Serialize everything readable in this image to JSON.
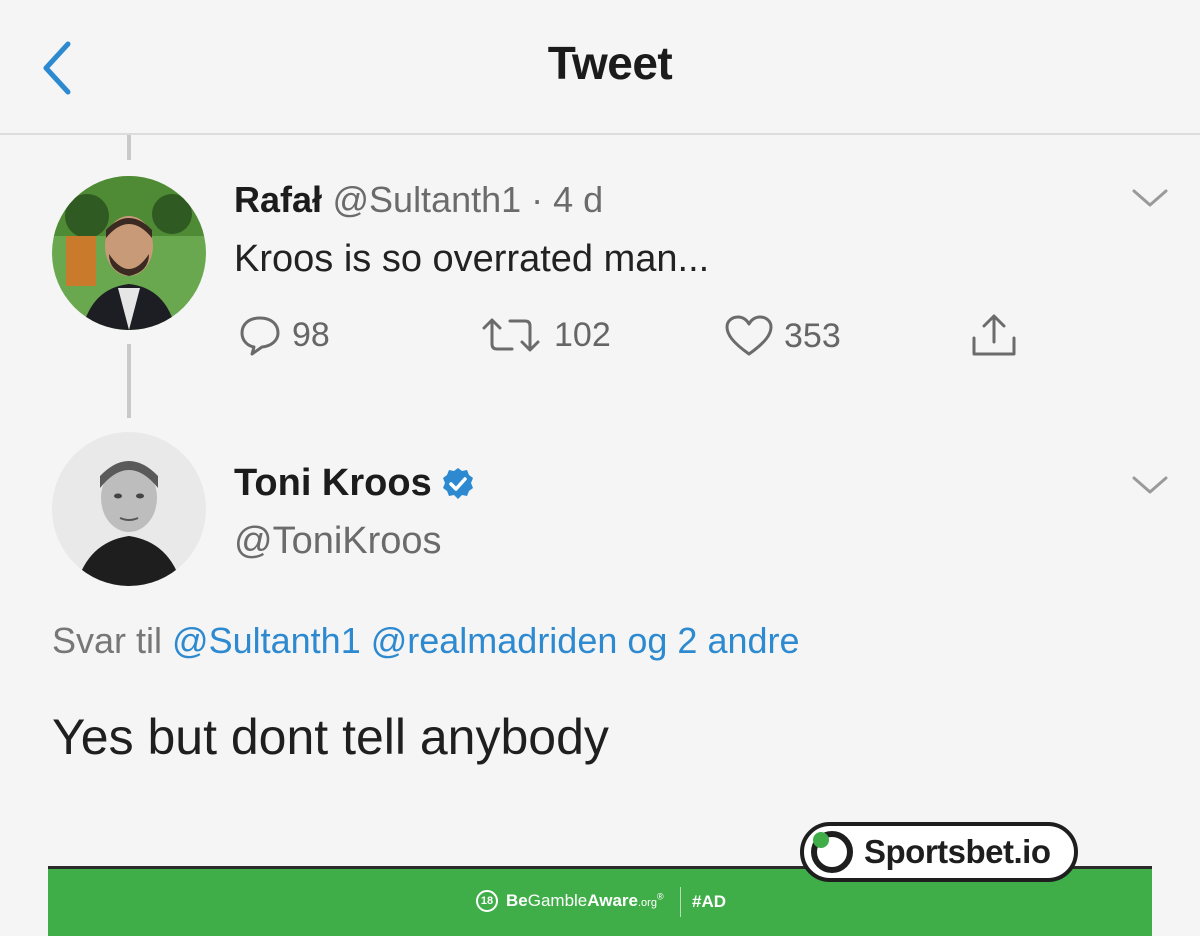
{
  "header": {
    "title": "Tweet"
  },
  "tweet1": {
    "name": "Rafał",
    "handle_time": "@Sultanth1 · 4 d",
    "text": "Kroos is so overrated man...",
    "replies": "98",
    "retweets": "102",
    "likes": "353"
  },
  "tweet2": {
    "name": "Toni Kroos",
    "handle": "@ToniKroos",
    "reply_prefix": "Svar til",
    "reply_mentions": "@Sultanth1 @realmadriden og 2 andre",
    "text": "Yes but dont tell anybody"
  },
  "ad": {
    "brand": "Sportsbet.io",
    "age_badge": "18",
    "be": "Be",
    "gamble": "Gamble",
    "aware": "Aware",
    "org": ".org",
    "registered": "®",
    "tag": "#AD"
  },
  "colors": {
    "link": "#2d8ad0",
    "verified": "#2d8ad0",
    "ad_green": "#3fae49",
    "back_arrow": "#2d8ad0"
  }
}
